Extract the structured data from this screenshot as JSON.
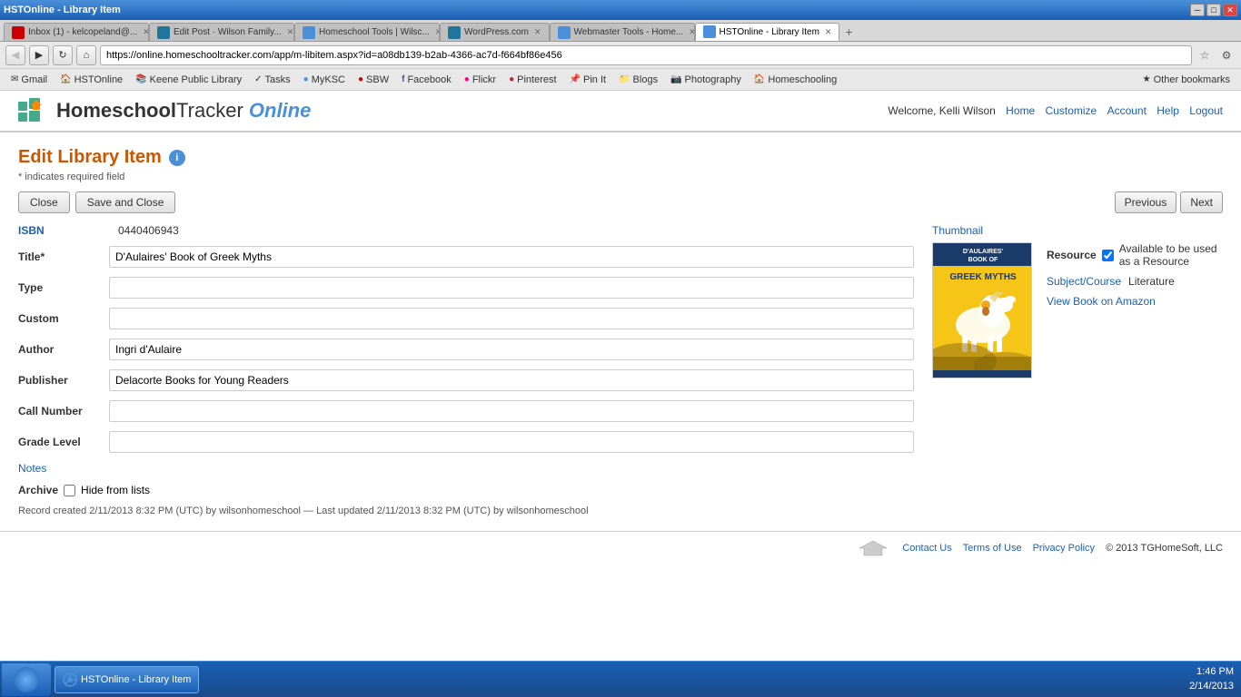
{
  "browser": {
    "title": "HSTOnline - Library Item",
    "address": "https://online.homeschooltracker.com/app/m-libitem.aspx?id=a08db139-b2ab-4366-ac7d-f664bf86e456",
    "tabs": [
      {
        "id": "tab-gmail",
        "label": "Inbox (1) - kelcopeland@...",
        "icon_color": "#cc0000",
        "active": false
      },
      {
        "id": "tab-editpost",
        "label": "Edit Post · Wilson Family...",
        "icon_color": "#21759b",
        "active": false
      },
      {
        "id": "tab-hsttools",
        "label": "Homeschool Tools | Wilsc...",
        "icon_color": "#4a90d9",
        "active": false
      },
      {
        "id": "tab-wordpress",
        "label": "WordPress.com",
        "icon_color": "#21759b",
        "active": false
      },
      {
        "id": "tab-webmaster",
        "label": "Webmaster Tools - Home...",
        "icon_color": "#4a90d9",
        "active": false
      },
      {
        "id": "tab-hst",
        "label": "HSTOnline - Library Item",
        "icon_color": "#4a90d9",
        "active": true
      }
    ],
    "bookmarks": [
      {
        "id": "bm-gmail",
        "label": "Gmail",
        "icon": "✉"
      },
      {
        "id": "bm-hst",
        "label": "HSTOnline",
        "icon": "🏠"
      },
      {
        "id": "bm-keene",
        "label": "Keene Public Library",
        "icon": "📚"
      },
      {
        "id": "bm-tasks",
        "label": "Tasks",
        "icon": "✓"
      },
      {
        "id": "bm-myksc",
        "label": "MyKSC",
        "icon": "●"
      },
      {
        "id": "bm-sbw",
        "label": "SBW",
        "icon": "●"
      },
      {
        "id": "bm-facebook",
        "label": "Facebook",
        "icon": "f"
      },
      {
        "id": "bm-flickr",
        "label": "Flickr",
        "icon": "●"
      },
      {
        "id": "bm-pinterest",
        "label": "Pinterest",
        "icon": "●"
      },
      {
        "id": "bm-pinit",
        "label": "Pin It",
        "icon": "●"
      },
      {
        "id": "bm-blogs",
        "label": "Blogs",
        "icon": "●"
      },
      {
        "id": "bm-photography",
        "label": "Photography",
        "icon": "📷"
      },
      {
        "id": "bm-homeschooling",
        "label": "Homeschooling",
        "icon": "🏠"
      },
      {
        "id": "bm-other",
        "label": "Other bookmarks",
        "icon": "★"
      }
    ]
  },
  "header": {
    "logo_text": "HomeschoolTracker",
    "logo_online": " Online",
    "welcome_text": "Welcome, Kelli Wilson",
    "nav_links": [
      {
        "id": "nav-home",
        "label": "Home"
      },
      {
        "id": "nav-customize",
        "label": "Customize"
      },
      {
        "id": "nav-account",
        "label": "Account"
      },
      {
        "id": "nav-help",
        "label": "Help"
      },
      {
        "id": "nav-logout",
        "label": "Logout"
      }
    ]
  },
  "page": {
    "title": "Edit Library Item",
    "required_note": "* indicates required field",
    "buttons": {
      "close": "Close",
      "save_close": "Save and Close",
      "previous": "Previous",
      "next": "Next"
    },
    "form": {
      "isbn_label": "ISBN",
      "isbn_value": "0440406943",
      "title_label": "Title*",
      "title_value": "D'Aulaires' Book of Greek Myths",
      "type_label": "Type",
      "type_value": "",
      "custom_label": "Custom",
      "custom_value": "",
      "author_label": "Author",
      "author_value": "Ingri d'Aulaire",
      "publisher_label": "Publisher",
      "publisher_value": "Delacorte Books for Young Readers",
      "call_number_label": "Call Number",
      "call_number_value": "",
      "grade_level_label": "Grade Level",
      "grade_level_value": ""
    },
    "thumbnail_label": "Thumbnail",
    "resource": {
      "label": "Resource",
      "checkbox_checked": true,
      "checkbox_label": "Available to be used as a Resource"
    },
    "subject_course": {
      "link_label": "Subject/Course",
      "value": "Literature"
    },
    "amazon_link": "View Book on Amazon",
    "notes_link": "Notes",
    "archive": {
      "label": "Archive",
      "checkbox_label": "Hide from lists",
      "checkbox_checked": false
    },
    "record_info": "Record created 2/11/2013 8:32 PM (UTC) by wilsonhomeschool — Last updated 2/11/2013 8:32 PM (UTC) by wilsonhomeschool"
  },
  "footer": {
    "contact_us": "Contact Us",
    "terms": "Terms of Use",
    "privacy": "Privacy Policy",
    "copyright": "© 2013 TGHomeSoft, LLC"
  },
  "taskbar": {
    "time": "1:46 PM",
    "date": "2/14/2013"
  }
}
